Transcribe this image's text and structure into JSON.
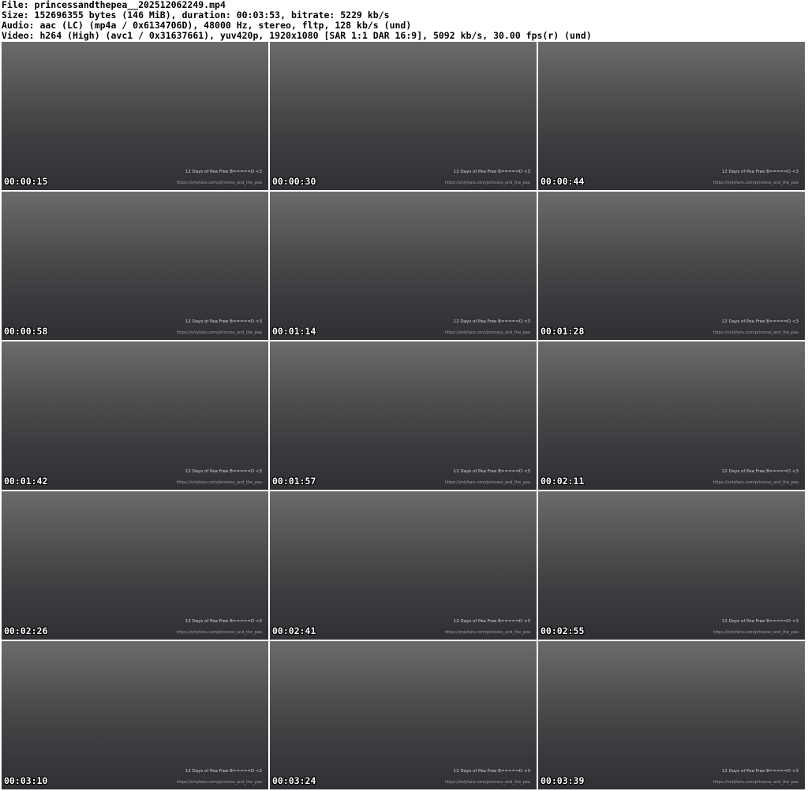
{
  "header": {
    "file": "File: princessandthepea__202512062249.mp4",
    "size": "Size: 152696355 bytes (146 MiB), duration: 00:03:53, bitrate: 5229 kb/s",
    "audio": "Audio: aac (LC) (mp4a / 0x6134706D), 48000 Hz, stereo, fltp, 128 kb/s (und)",
    "video": "Video: h264 (High) (avc1 / 0x31637661), yuv420p, 1920x1080 [SAR 1:1 DAR 16:9], 5092 kb/s, 30.00 fps(r) (und)"
  },
  "watermark": {
    "line1": "12 Days of Pea Free B=====D <3",
    "line2": "https://onlyfans.com/princess_and_the_pea"
  },
  "thumbnails": [
    "00:00:15",
    "00:00:30",
    "00:00:44",
    "00:00:58",
    "00:01:14",
    "00:01:28",
    "00:01:42",
    "00:01:57",
    "00:02:11",
    "00:02:26",
    "00:02:41",
    "00:02:55",
    "00:03:10",
    "00:03:24",
    "00:03:39"
  ]
}
